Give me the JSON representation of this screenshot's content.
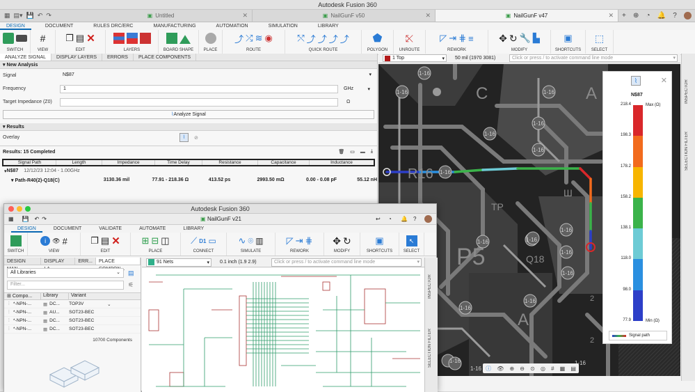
{
  "main_window": {
    "title": "Autodesk Fusion 360",
    "doc_tabs": [
      {
        "label": "Untitled",
        "active": false
      },
      {
        "label": "NailGunF v50",
        "active": false
      },
      {
        "label": "NailGunF v47",
        "active": true
      }
    ],
    "ribbon_tabs": [
      "DESIGN",
      "DOCUMENT",
      "RULES DRC/ERC",
      "MANUFACTURING",
      "AUTOMATION",
      "SIMULATION",
      "LIBRARY"
    ],
    "ribbon_groups": [
      "SWITCH",
      "VIEW",
      "EDIT",
      "LAYERS",
      "BOARD SHAPE",
      "PLACE",
      "ROUTE",
      "QUICK ROUTE",
      "POLYGON",
      "UNROUTE",
      "REWORK",
      "MODIFY",
      "SHORTCUTS",
      "SELECT"
    ],
    "panel_tabs": [
      "ANALYZE SIGNAL",
      "DISPLAY LAYERS",
      "ERRORS",
      "PLACE COMPONENTS"
    ],
    "new_analysis": {
      "header": "New Analysis",
      "signal_label": "Signal",
      "signal_value": "N$87",
      "frequency_label": "Frequency",
      "frequency_value": "1",
      "frequency_unit": "GHz",
      "impedance_label": "Target Impedance (Z0)",
      "impedance_value": "",
      "impedance_unit": "Ω",
      "analyze_button": "Analyze Signal"
    },
    "results": {
      "header": "Results",
      "overlay_label": "Overlay",
      "completed": "Results: 15 Completed",
      "columns": [
        "Signal Path",
        "Length",
        "Impedance",
        "Time Delay",
        "Resistance",
        "Capacitance",
        "Inductance"
      ],
      "net_row": {
        "net": "N$87",
        "date": "12/12/23 12:04 - 1.00GHz"
      },
      "path_row": {
        "name": "Path-R40(2)-Q18(C)",
        "length": "3130.36 mil",
        "impedance": "77.91 - 218.36 Ω",
        "delay": "413.52 ps",
        "resistance": "2993.50 mΩ",
        "capacitance": "0.00 - 0.08 pF",
        "inductance": "55.12 nH"
      }
    },
    "canvas_bar": {
      "layer": "1 Top",
      "grid": "50 mil (1970 3081)",
      "command_placeholder": "Click or press / to activate command line mode"
    },
    "legend": {
      "net": "N$87",
      "max_label": "Max (Ω)",
      "min_label": "Min (Ω)",
      "ticks": [
        "218.4",
        "198.3",
        "178.2",
        "158.2",
        "138.1",
        "118.0",
        "98.0",
        "77.9"
      ],
      "signal_path_label": "Signal path",
      "colors": [
        "#d9272a",
        "#f26b1d",
        "#f7b500",
        "#3bb34a",
        "#6dcbd5",
        "#2a8fe0",
        "#2d3fc8"
      ]
    },
    "rail_labels": [
      "INSPECTOR",
      "SELECTION FILTER"
    ],
    "board_labels": [
      "C",
      "A",
      "R16",
      "TP",
      "P5",
      "Q18",
      "A",
      "Ш",
      "B",
      "2",
      "2"
    ],
    "pad_labels": [
      "1-16",
      "1-16",
      "1-16",
      "1-16",
      "1-16",
      "1-16",
      "1-16",
      "1-16",
      "1-16",
      "1-16",
      "1-16",
      "1-16",
      "1-16",
      "1-16",
      "1-16",
      "1-16",
      "1-16",
      "1-16",
      "1-16"
    ]
  },
  "second_window": {
    "title": "Autodesk Fusion 360",
    "doc_title": "NailGunF v21",
    "ribbon_tabs": [
      "DESIGN",
      "DOCUMENT",
      "VALIDATE",
      "AUTOMATE",
      "LIBRARY"
    ],
    "ribbon_groups": [
      "SWITCH",
      "VIEW",
      "EDIT",
      "PLACE",
      "CONNECT",
      "SIMULATE",
      "REWORK",
      "MODIFY",
      "SHORTCUTS",
      "SELECT"
    ],
    "panel_tabs": [
      "DESIGN MAN...",
      "DISPLAY LA...",
      "ERR...",
      "PLACE COMPON..."
    ],
    "library_select": "All Libraries",
    "filter_placeholder": "Filter...",
    "columns": [
      "Compo...",
      "Library",
      "Variant"
    ],
    "rows": [
      {
        "comp": "*-NPN-...",
        "lib": "DC...",
        "variant": "TOP3V"
      },
      {
        "comp": "*-NPN-...",
        "lib": "AU...",
        "variant": "SOT23-BEC"
      },
      {
        "comp": "*-NPN-...",
        "lib": "DC...",
        "variant": "SOT23-BEC"
      },
      {
        "comp": "*-NPN-...",
        "lib": "DC...",
        "variant": "SOT23-BEC"
      }
    ],
    "component_count": "10700 Components",
    "net_select": "91 Nets",
    "grid": "0.1 inch (1.9 2.9)",
    "command_placeholder": "Click or press / to activate command line mode",
    "rail_labels": [
      "INSPECTOR",
      "SELECTION FILTER"
    ],
    "d1_label": "D1"
  }
}
